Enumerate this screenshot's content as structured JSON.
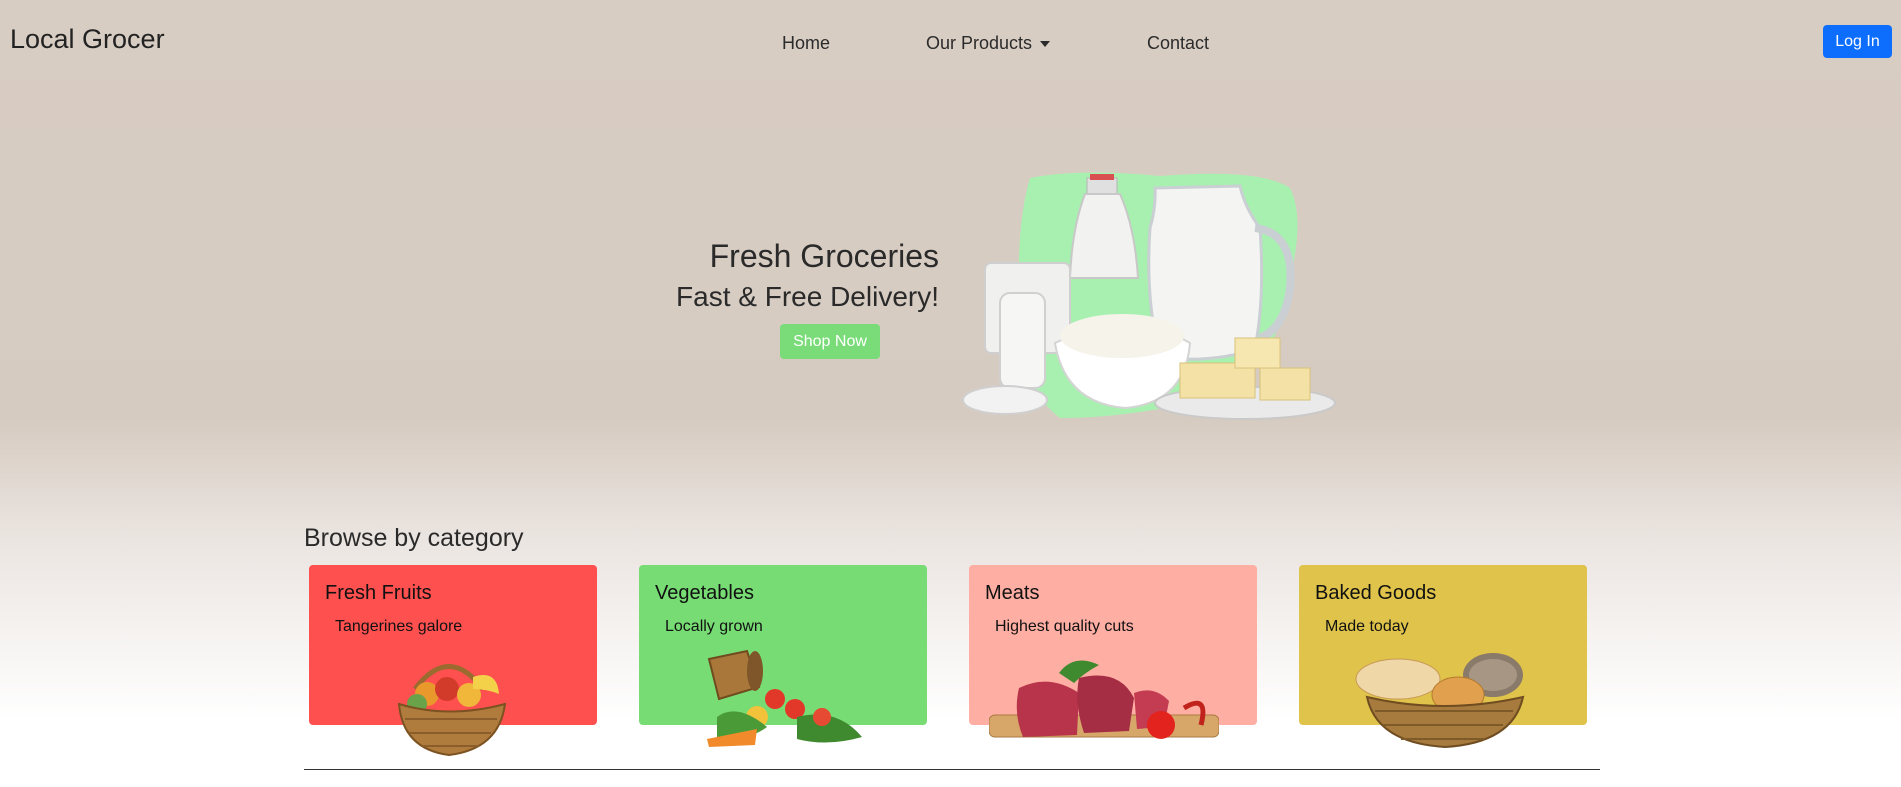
{
  "navbar": {
    "brand": "Local Grocer",
    "links": [
      {
        "label": "Home"
      },
      {
        "label": "Our Products",
        "has_dropdown": true
      },
      {
        "label": "Contact"
      }
    ],
    "login_label": "Log In",
    "login_color": "#0d6efd"
  },
  "hero": {
    "title": "Fresh Groceries",
    "subtitle": "Fast & Free Delivery!",
    "cta_label": "Shop Now",
    "cta_color": "#79dc78",
    "image": "dairy-products-image"
  },
  "categories": {
    "heading": "Browse by category",
    "items": [
      {
        "title": "Fresh Fruits",
        "text": "Tangerines galore",
        "color": "#ff5050",
        "image": "fruit-basket-image"
      },
      {
        "title": "Vegetables",
        "text": "Locally grown",
        "color": "#77dc74",
        "image": "vegetable-bucket-image"
      },
      {
        "title": "Meats",
        "text": "Highest quality cuts",
        "color": "#ffaea3",
        "image": "meat-board-image"
      },
      {
        "title": "Baked Goods",
        "text": "Made today",
        "color": "#dfc34a",
        "image": "bread-basket-image"
      }
    ]
  }
}
